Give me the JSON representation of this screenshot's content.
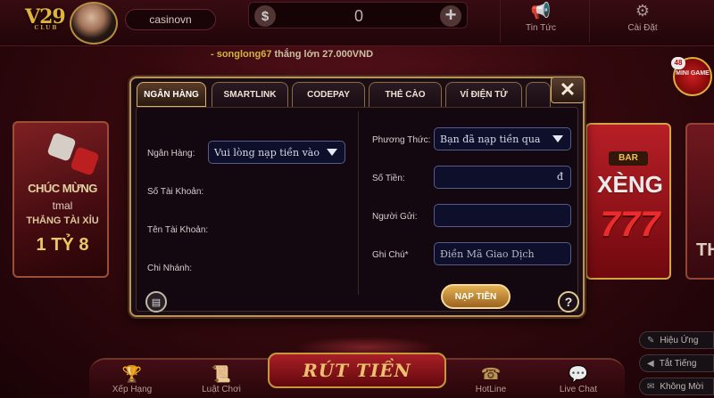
{
  "header": {
    "logo": "V29",
    "logo_sub": "CLUB",
    "username": "casinovn",
    "balance": "0",
    "currency_symbol": "$",
    "add_symbol": "+",
    "news_label": "Tin Tức",
    "settings_label": "Cài Đặt"
  },
  "ticker": {
    "user": "- songlong67",
    "message": "thắng lớn 27.000VND"
  },
  "mini_game": {
    "badge": "48",
    "label": "MINI GAME"
  },
  "tiles": {
    "left": {
      "line1": "CHÚC MỪNG",
      "line2": "tmal",
      "line3": "THẮNG TÀI XỈU",
      "line4": "1 TỶ 8"
    },
    "slot": {
      "bar": "BAR",
      "title": "XÈNG",
      "number": "777"
    },
    "far": {
      "text": "TH"
    }
  },
  "side_buttons": {
    "effects": "Hiệu Ứng",
    "sound_off": "Tắt Tiếng",
    "no_invite": "Không Mời"
  },
  "bottom": {
    "ranking": "Xếp Hạng",
    "rules": "Luật Chơi",
    "withdraw": "RÚT TIỀN",
    "hotline": "HotLine",
    "live_chat": "Live Chat"
  },
  "modal": {
    "tabs": [
      {
        "label": "NGÂN HÀNG",
        "active": true
      },
      {
        "label": "SMARTLINK",
        "active": false
      },
      {
        "label": "CODEPAY",
        "active": false
      },
      {
        "label": "THẺ CÀO",
        "active": false
      },
      {
        "label": "VÍ ĐIỆN TỬ",
        "active": false
      }
    ],
    "close": "✕",
    "left": {
      "bank_label": "Ngân Hàng:",
      "bank_select": "Vui lòng nạp tiền vào",
      "account_no_label": "Số Tài Khoản:",
      "account_name_label": "Tên Tài Khoản:",
      "branch_label": "Chi Nhánh:"
    },
    "right": {
      "method_label": "Phương Thức:",
      "method_select": "Bạn đã nạp tiền qua",
      "amount_label": "Số Tiền:",
      "amount_value": "",
      "currency": "đ",
      "sender_label": "Người Gửi:",
      "sender_value": "",
      "note_label": "Ghi Chú*",
      "note_placeholder": "Điền Mã Giao Dịch"
    },
    "submit": "NẠP TIỀN",
    "help": "?"
  }
}
